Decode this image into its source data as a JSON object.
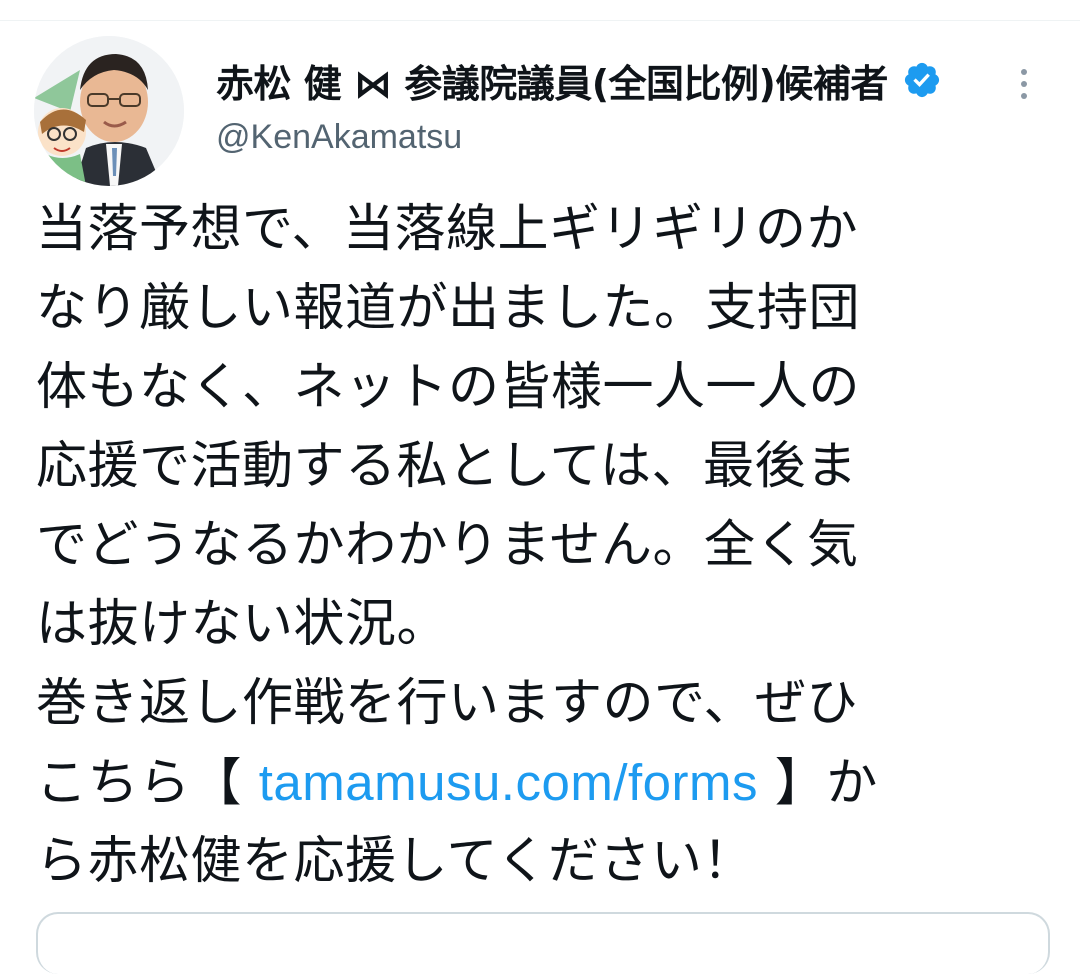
{
  "author": {
    "display_name": "赤松 健 ⋈ 参議院議員(全国比例)候補者",
    "handle": "@KenAkamatsu",
    "verified": true
  },
  "tweet": {
    "lines": [
      "当落予想で、当落線上ギリギリのか",
      "なり厳しい報道が出ました。支持団",
      "体もなく、ネットの皆様一人一人の",
      "応援で活動する私としては、最後ま",
      "でどうなるかわかりません。全く気",
      "は抜けない状況。",
      "巻き返し作戦を行いますので、ぜひ"
    ],
    "link_line": {
      "before": "こちら【 ",
      "link_text": "tamamusu.com/forms",
      "after": " 】か"
    },
    "last_line": "ら赤松健を応援してください！"
  },
  "colors": {
    "link": "#1d9bf0",
    "verified": "#1d9bf0",
    "text": "#0f1419",
    "secondary": "#536471"
  },
  "icons": {
    "avatar": "avatar-illustration",
    "verified": "verified-badge-icon",
    "more": "more-options-icon"
  }
}
